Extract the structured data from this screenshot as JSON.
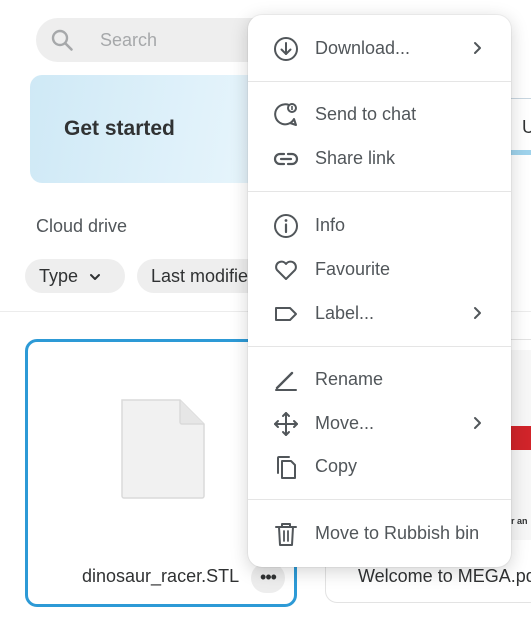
{
  "search": {
    "placeholder": "Search"
  },
  "banner": {
    "title": "Get started",
    "right_tab_partial": "U"
  },
  "section": {
    "title": "Cloud drive"
  },
  "filters": {
    "type_label": "Type",
    "modified_label": "Last modified"
  },
  "files": [
    {
      "name": "dinosaur_racer.STL",
      "more_label": "•••"
    },
    {
      "name": "Welcome to MEGA.pdf",
      "thumb_text": "er an"
    }
  ],
  "menu": {
    "items": [
      {
        "label": "Download...",
        "icon": "download-icon",
        "submenu": true
      },
      {
        "label": "Send to chat",
        "icon": "send-to-chat-icon",
        "submenu": false
      },
      {
        "label": "Share link",
        "icon": "link-icon",
        "submenu": false
      },
      {
        "label": "Info",
        "icon": "info-icon",
        "submenu": false
      },
      {
        "label": "Favourite",
        "icon": "heart-icon",
        "submenu": false
      },
      {
        "label": "Label...",
        "icon": "label-icon",
        "submenu": true
      },
      {
        "label": "Rename",
        "icon": "pencil-icon",
        "submenu": false
      },
      {
        "label": "Move...",
        "icon": "move-icon",
        "submenu": true
      },
      {
        "label": "Copy",
        "icon": "copy-icon",
        "submenu": false
      },
      {
        "label": "Move to Rubbish bin",
        "icon": "trash-icon",
        "submenu": false
      }
    ]
  },
  "colors": {
    "accent": "#2d9ad6",
    "banner": "#dff1fa",
    "danger_red": "#d1242a"
  }
}
